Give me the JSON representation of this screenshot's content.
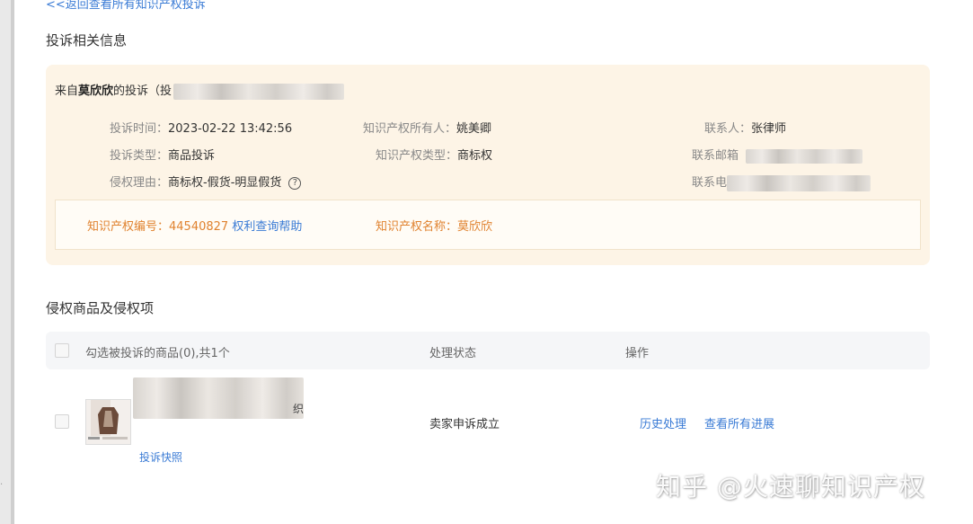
{
  "back_link": "<<返回查看所有知识产权投诉",
  "section1_title": "投诉相关信息",
  "complaint": {
    "from_prefix": "来自",
    "from_name": "莫欣欣",
    "from_suffix": "的投诉（",
    "from_id_partial": "投",
    "time_label": "投诉时间：",
    "time_value": "2023-02-22 13:42:56",
    "type_label": "投诉类型：",
    "type_value": "商品投诉",
    "reason_label": "侵权理由：",
    "reason_value": "商标权-假货-明显假货",
    "owner_label": "知识产权所有人：",
    "owner_value": "姚美卿",
    "iptype_label": "知识产权类型：",
    "iptype_value": "商标权",
    "contact_label": "联系人：",
    "contact_value": "张律师",
    "email_label": "联系邮箱",
    "phone_label": "联系电",
    "ip_number_label": "知识产权编号：",
    "ip_number_value": "44540827",
    "rights_link": "权利查询帮助",
    "ip_name_label": "知识产权名称：",
    "ip_name_value": "莫欣欣"
  },
  "section2_title": "侵权商品及侵权项",
  "table": {
    "select_header": "勾选被投诉的商品(0),共1个",
    "status_header": "处理状态",
    "action_header": "操作",
    "row": {
      "product_suffix": "织",
      "snapshot_link": "投诉快照",
      "status": "卖家申诉成立",
      "history_link": "历史处理",
      "progress_link": "查看所有进展"
    }
  },
  "watermark": "知乎 @火速聊知识产权"
}
